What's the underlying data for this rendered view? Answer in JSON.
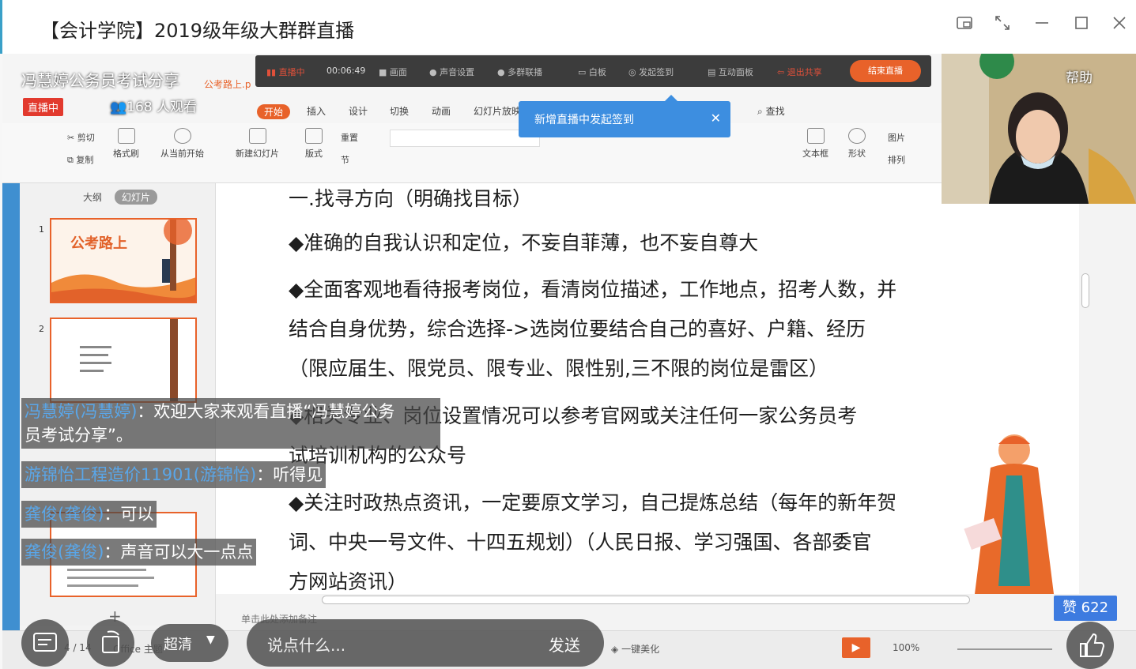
{
  "window": {
    "title": "【会计学院】2019级年级大群群直播",
    "controls": [
      "pip-icon",
      "expand-icon",
      "minimize-icon",
      "maximize-icon",
      "close-icon"
    ]
  },
  "live": {
    "title": "冯慧婷公务员考试分享",
    "badge": "直播中",
    "viewers": "168 人观看",
    "help": "帮助",
    "toolbar": {
      "status": "直播中",
      "time": "00:06:49",
      "items": [
        "画面",
        "声音设置",
        "多群联播",
        "白板",
        "发起签到",
        "互动面板",
        "退出共享"
      ],
      "end_button": "结束直播"
    },
    "toast": "新增直播中发起签到",
    "likes": "赞 622",
    "quality": "超清",
    "comment_placeholder": "说点什么...",
    "send": "发送"
  },
  "ppt": {
    "file_tab": "公考路上.p",
    "tabs": [
      "开始",
      "插入",
      "设计",
      "切换",
      "动画",
      "幻灯片放映"
    ],
    "search": "查找",
    "ribbon": [
      "剪切",
      "复制",
      "格式刷",
      "从当前开始",
      "新建幻灯片",
      "版式",
      "重置",
      "节",
      "文本框",
      "形状",
      "图片",
      "排列"
    ],
    "pane_tabs": [
      "大纲",
      "幻灯片"
    ],
    "thumb_title_1": "公考路上",
    "slide_numbers": [
      "1",
      "2"
    ],
    "notes": "单击此处添加备注",
    "page_indicator": "4 / 14",
    "theme": "Office 主题",
    "beautify": "一键美化",
    "zoom": "100%"
  },
  "slide": {
    "lines": [
      "一.找寻方向（明确找目标）",
      "◆准确的自我认识和定位，不妄自菲薄，也不妄自尊大",
      "◆全面客观地看待报考岗位，看清岗位描述，工作地点，招考人数，并",
      "结合自身优势，综合选择->选岗位要结合自己的喜好、户籍、经历",
      "（限应届生、限党员、限专业、限性别,三不限的岗位是雷区）",
      "◆相关专业、岗位设置情况可以参考官网或关注任何一家公务员考",
      "试培训机构的公众号",
      "◆关注时政热点资讯，一定要原文学习，自己提炼总结（每年的新年贺",
      "词、中央一号文件、十四五规划）（人民日报、学习强国、各部委官",
      "方网站资讯）"
    ]
  },
  "chat": [
    {
      "name": "冯慧婷(冯慧婷)",
      "text": "：欢迎大家来观看直播“冯慧婷公务",
      "cont": "员考试分享”。"
    },
    {
      "name": "游锦怡工程造价11901(游锦怡)",
      "text": "：听得见"
    },
    {
      "name": "龚俊(龚俊)",
      "text": "：可以"
    },
    {
      "name": "龚俊(龚俊)",
      "text": "：声音可以大一点点"
    }
  ],
  "colors": {
    "accent": "#e8622a",
    "live_red": "#e23a2e",
    "toast_blue": "#3d8ee0",
    "chat_name": "#5aa6e8"
  }
}
